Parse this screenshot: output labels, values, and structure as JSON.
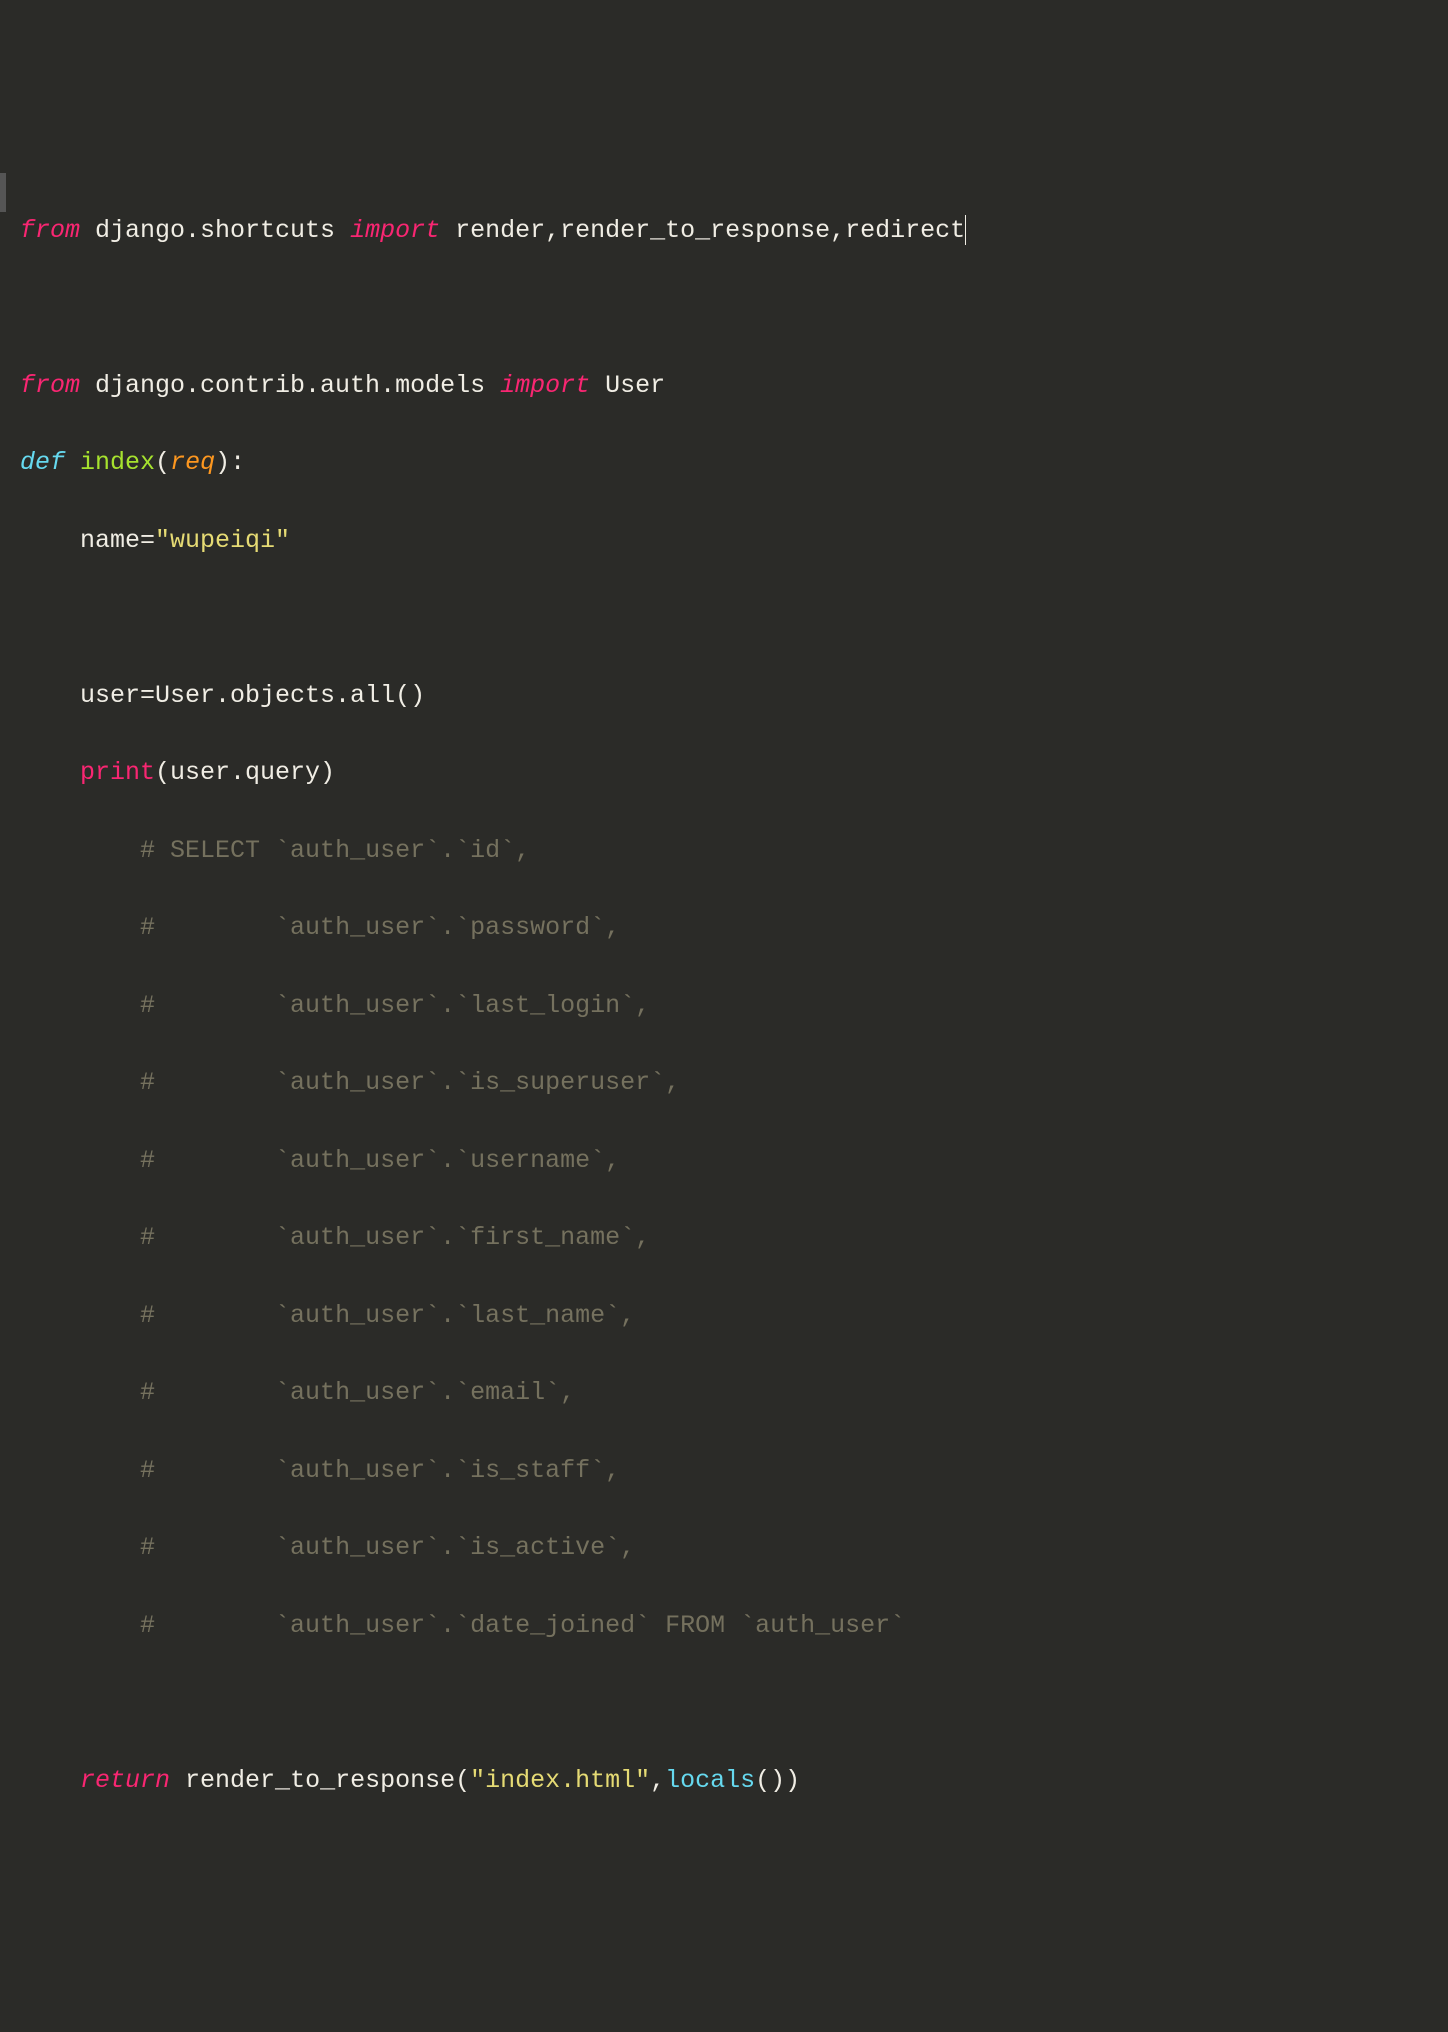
{
  "code": {
    "l1": {
      "from": "from",
      "mod1": " django.shortcuts ",
      "import": "import",
      "names": " render,render_to_response,redirect"
    },
    "l2": "",
    "l3": {
      "from": "from",
      "mod": " django.contrib.auth.models ",
      "import": "import",
      "names": " User"
    },
    "l4": {
      "def": "def",
      "sp": " ",
      "fn": "index",
      "lparen": "(",
      "param": "req",
      "rparen": "):"
    },
    "l5": {
      "indent": "    ",
      "var": "name=",
      "str": "\"wupeiqi\""
    },
    "l6": "",
    "l7": {
      "indent": "    ",
      "text": "user=User.objects.all()"
    },
    "l8": {
      "indent": "    ",
      "call": "print",
      "args": "(user.query)"
    },
    "l9": {
      "indent": "        ",
      "c": "# SELECT `auth_user`.`id`,"
    },
    "l10": {
      "indent": "        ",
      "c": "#        `auth_user`.`password`,"
    },
    "l11": {
      "indent": "        ",
      "c": "#        `auth_user`.`last_login`,"
    },
    "l12": {
      "indent": "        ",
      "c": "#        `auth_user`.`is_superuser`,"
    },
    "l13": {
      "indent": "        ",
      "c": "#        `auth_user`.`username`,"
    },
    "l14": {
      "indent": "        ",
      "c": "#        `auth_user`.`first_name`,"
    },
    "l15": {
      "indent": "        ",
      "c": "#        `auth_user`.`last_name`,"
    },
    "l16": {
      "indent": "        ",
      "c": "#        `auth_user`.`email`,"
    },
    "l17": {
      "indent": "        ",
      "c": "#        `auth_user`.`is_staff`,"
    },
    "l18": {
      "indent": "        ",
      "c": "#        `auth_user`.`is_active`,"
    },
    "l19": {
      "indent": "        ",
      "c": "#        `auth_user`.`date_joined` FROM `auth_user`"
    },
    "l20": "",
    "l21": {
      "indent": "    ",
      "return": "return",
      "sp": " ",
      "fn": "render_to_response(",
      "str": "\"index.html\"",
      "comma": ",",
      "builtin": "locals",
      "end": "())"
    }
  }
}
